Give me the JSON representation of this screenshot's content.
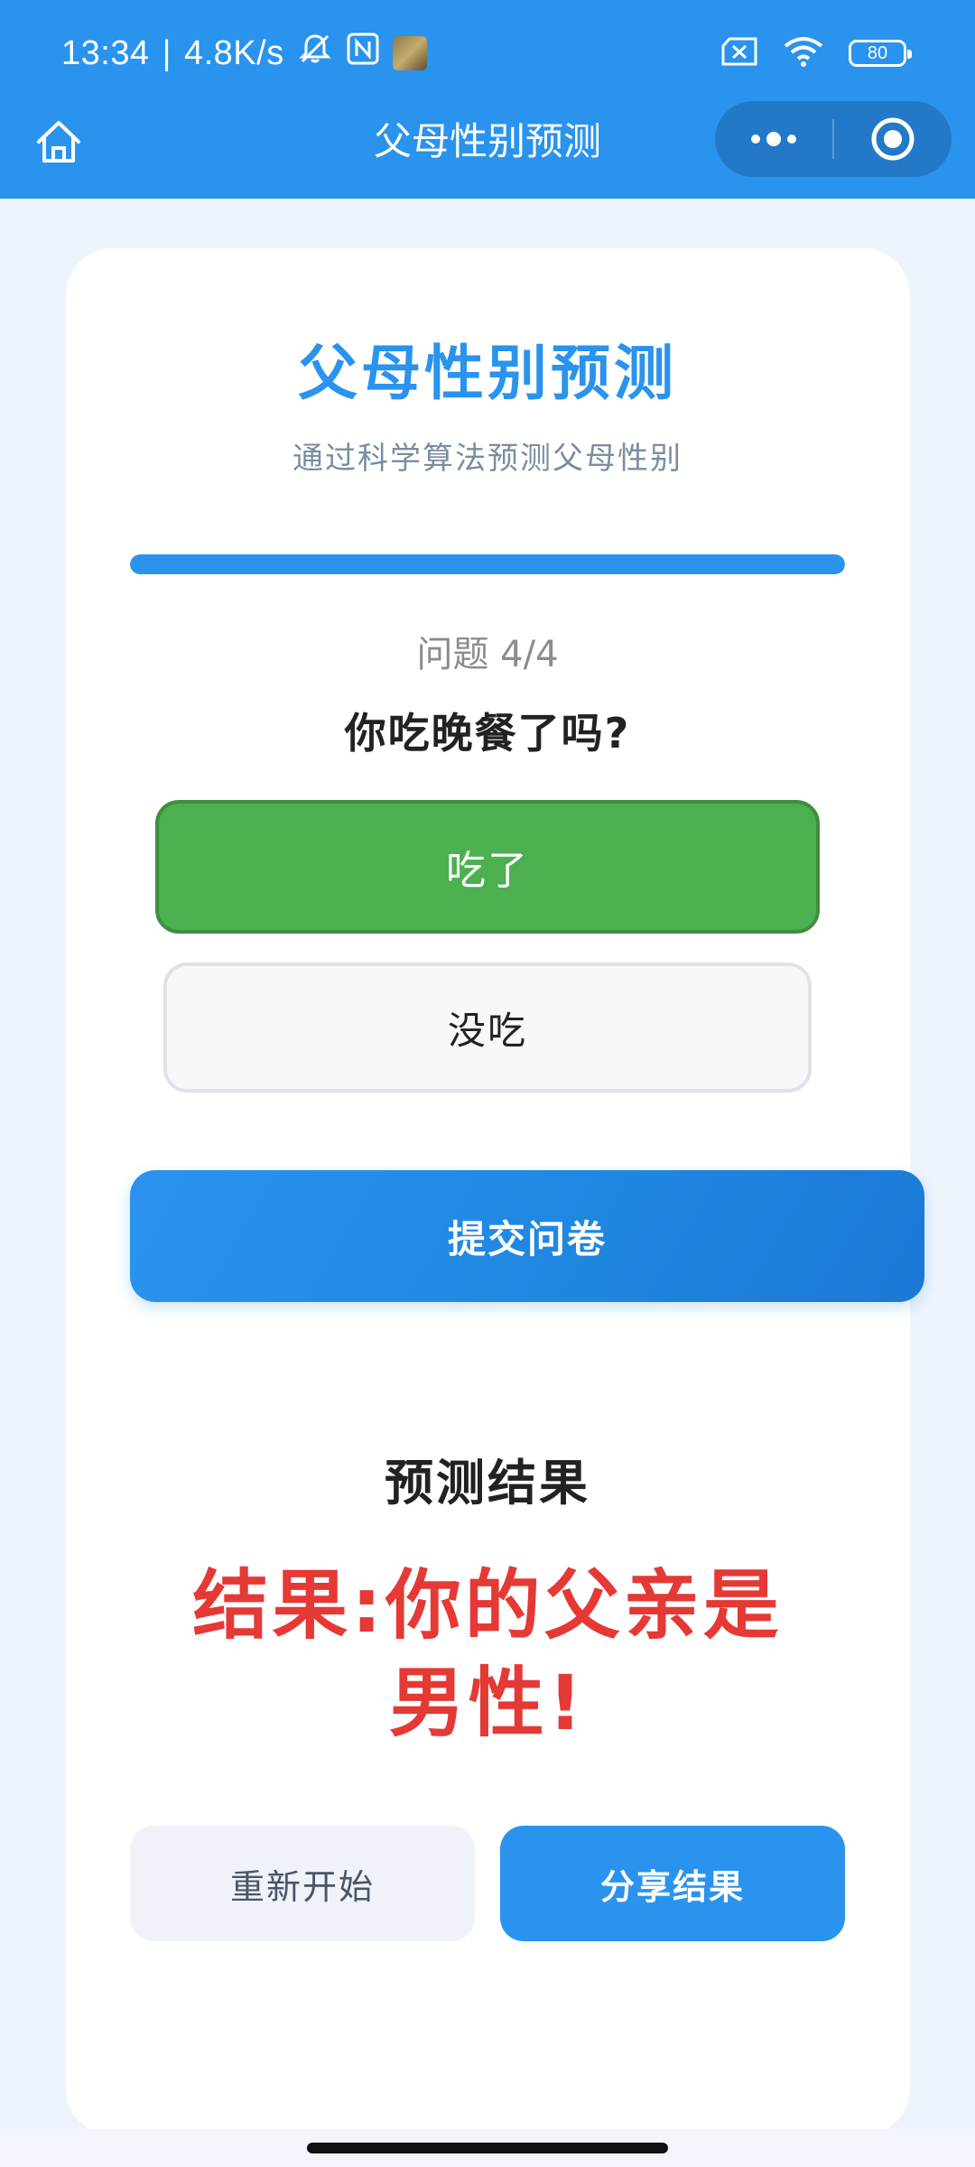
{
  "status_bar": {
    "time": "13:34",
    "separator": "|",
    "network_speed": "4.8K/s",
    "battery_level": "80",
    "icons": [
      "mute-bell-icon",
      "nfc-icon",
      "app-thumbnail-icon",
      "sim-off-icon",
      "wifi-icon",
      "battery-icon"
    ]
  },
  "app_bar": {
    "title": "父母性别预测",
    "home_icon": "home-icon",
    "more_icon": "more-dots-icon",
    "close_icon": "target-close-icon"
  },
  "card": {
    "title": "父母性别预测",
    "subtitle": "通过科学算法预测父母性别",
    "progress": 1.0,
    "question_counter": "问题 4/4",
    "question": "你吃晚餐了吗?",
    "options": [
      {
        "label": "吃了",
        "selected": true
      },
      {
        "label": "没吃",
        "selected": false
      }
    ],
    "submit_label": "提交问卷",
    "result_heading": "预测结果",
    "result_text": "结果:你的父亲是男性!",
    "restart_label": "重新开始",
    "share_label": "分享结果"
  },
  "colors": {
    "primary": "#2a93ee",
    "selected_option": "#4caf50",
    "result_text": "#e53935"
  }
}
